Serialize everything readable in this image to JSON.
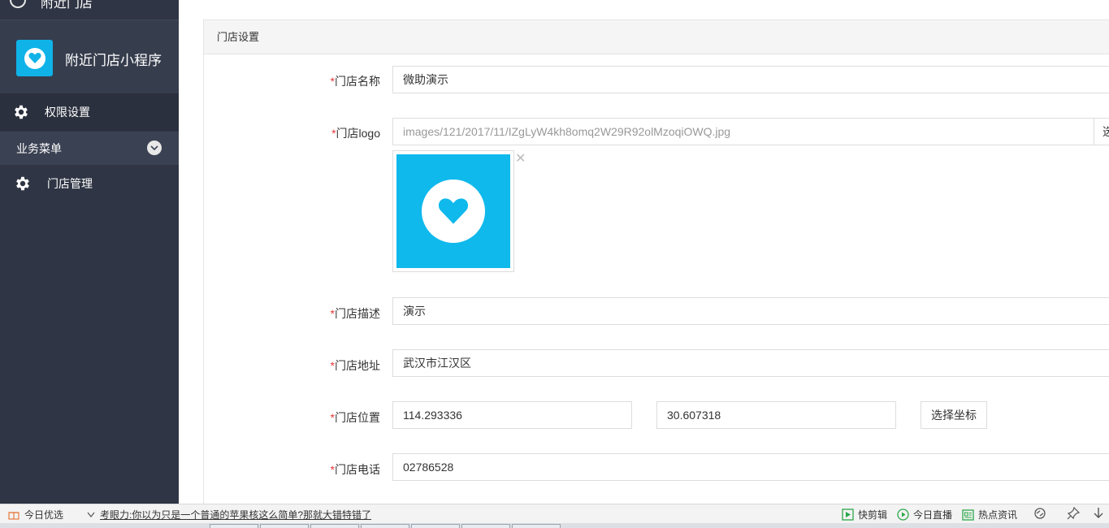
{
  "sidebar": {
    "top_item": "附近门店",
    "brand_name": "附近门店小程序",
    "items": [
      {
        "label": "权限设置"
      },
      {
        "label": "业务菜单"
      },
      {
        "label": "门店管理"
      }
    ]
  },
  "panel": {
    "title": "门店设置"
  },
  "form": {
    "name": {
      "label": "门店名称",
      "value": "微助演示"
    },
    "logo": {
      "label": "门店logo",
      "value": "images/121/2017/11/IZgLyW4kh8omq2W29R92olMzoqiOWQ.jpg",
      "select_button_partial": "选"
    },
    "desc": {
      "label": "门店描述",
      "value": "演示"
    },
    "address": {
      "label": "门店地址",
      "value": "武汉市江汉区"
    },
    "position": {
      "label": "门店位置",
      "lng": "114.293336",
      "lat": "30.607318",
      "pick_button": "选择坐标"
    },
    "phone": {
      "label": "门店电话",
      "value": "02786528"
    },
    "required_mark": "*"
  },
  "colors": {
    "sidebar_bg": "#2f3544",
    "brand_accent": "#0fb3e8",
    "required_red": "#e4393c"
  },
  "newsbar": {
    "today_pick": "今日优选",
    "headline": "考眼力:你以为只是一个普通的苹果核这么简单?那就大错特错了",
    "quick_cut": "快剪辑",
    "today_live": "今日直播",
    "hot_news": "热点资讯"
  }
}
